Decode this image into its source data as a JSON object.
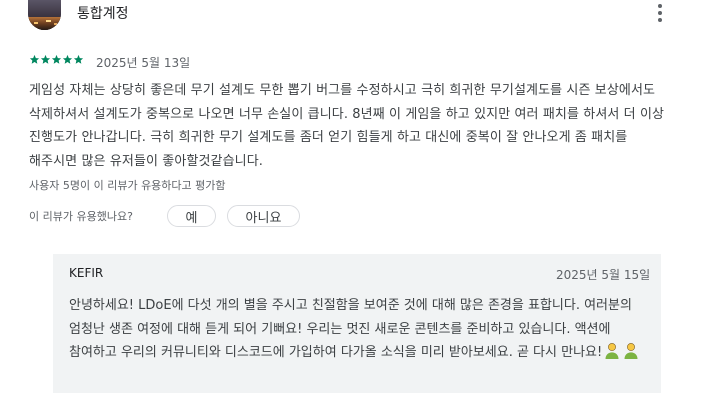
{
  "review": {
    "user_name": "통합계정",
    "rating": 5,
    "date": "2025년 5월 13일",
    "text": "게임성 자체는 상당히 좋은데 무기 설계도 무한 뽑기 버그를 수정하시고 극히 희귀한 무기설계도를 시즌 보상에서도 삭제하셔서 설계도가 중복으로 나오면 너무 손실이 큽니다. 8년째 이 게임을 하고 있지만 여러 패치를 하셔서 더 이상 진행도가 안나갑니다. 극히 희귀한 무기 설계도를 좀더 얻기 힘들게 하고 대신에 중복이 잘 안나오게 좀 패치를 해주시면 많은 유저들이 좋아할것같습니다.",
    "helpful_count_text": "사용자 5명이 이 리뷰가 유용하다고 평가함",
    "helpful_question": "이 리뷰가 유용했나요?",
    "yes_label": "예",
    "no_label": "아니요"
  },
  "reply": {
    "developer": "KEFIR",
    "date": "2025년 5월 15일",
    "text": "안녕하세요! LDoE에 다섯 개의 별을 주시고 친절함을 보여준 것에 대해 많은 존경을 표합니다. 여러분의 엄청난 생존 여정에 대해 듣게 되어 기뻐요! 우리는 멋진 새로운 콘텐츠를 준비하고 있습니다. 액션에 참여하고 우리의 커뮤니티와 디스코드에 가입하여 다가올 소식을 미리 받아보세요. 곧 다시 만나요!"
  },
  "icons": {
    "more": "more-vert-icon",
    "star": "star-icon",
    "emoji": "people-emoji-icon"
  },
  "colors": {
    "star": "#01875f",
    "reply_bg": "#f1f3f4",
    "text": "#3c4043"
  }
}
